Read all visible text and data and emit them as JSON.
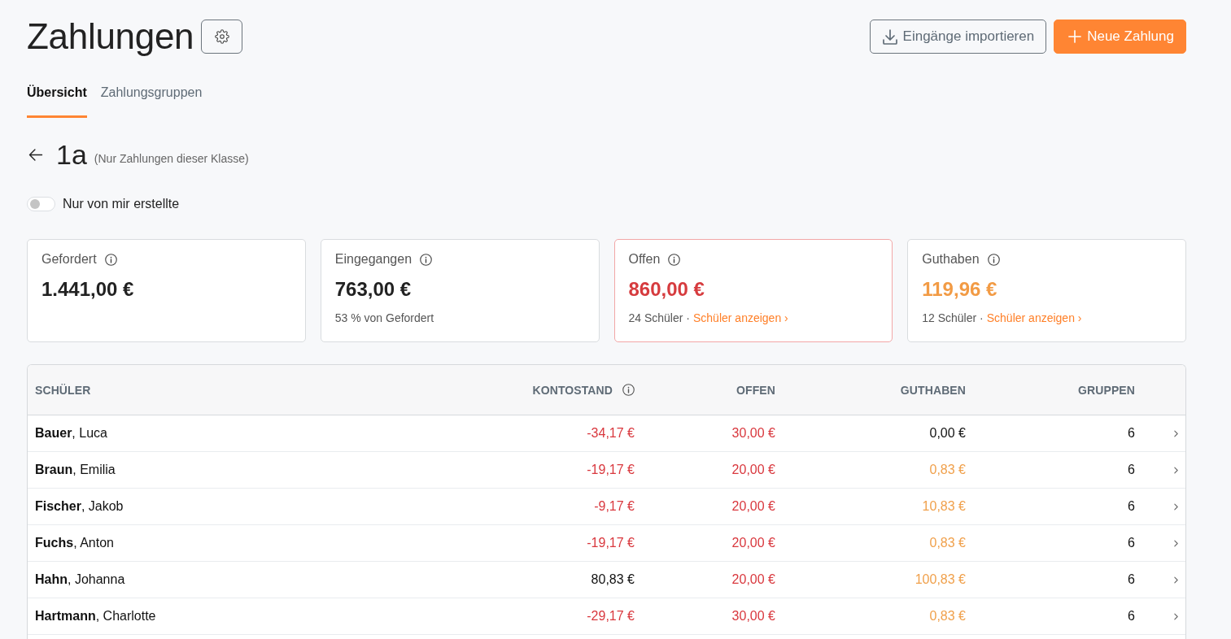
{
  "header": {
    "title": "Zahlungen",
    "actions": [
      {
        "label": "Eingänge importieren",
        "kind": "secondary"
      },
      {
        "label": "Neue Zahlung",
        "kind": "primary"
      }
    ]
  },
  "tabs": [
    {
      "label": "Übersicht",
      "selected": true
    },
    {
      "label": "Zahlungsgruppen",
      "selected": false
    }
  ],
  "class_filter": {
    "title": "1a",
    "subtitle": "(Nur Zahlungen dieser Klasse)"
  },
  "toggle": {
    "label": "Nur von mir erstellte",
    "on": false
  },
  "stats": [
    {
      "label": "Gefordert",
      "value": "1.441,00 €",
      "color": "#222222",
      "alert": false
    },
    {
      "label": "Eingegangen",
      "value": "763,00 €",
      "color": "#222222",
      "note": "53 % von Gefordert",
      "alert": false
    },
    {
      "label": "Offen",
      "value": "860,00 €",
      "color": "#d63b3e",
      "note": "24 Schüler ·",
      "link": "Schüler anzeigen ›",
      "alert": true
    },
    {
      "label": "Guthaben",
      "value": "119,96 €",
      "color": "#f29b45",
      "note": "12 Schüler ·",
      "link": "Schüler anzeigen ›",
      "alert": false
    }
  ],
  "table": {
    "columns": [
      {
        "label": "SCHÜLER",
        "info": false
      },
      {
        "label": "KONTOSTAND",
        "info": true
      },
      {
        "label": "OFFEN",
        "info": false
      },
      {
        "label": "GUTHABEN",
        "info": false
      },
      {
        "label": "GRUPPEN",
        "info": false
      }
    ],
    "rows": [
      {
        "student": "**Bauer**, Luca",
        "balance": {
          "text": "-34,17 €",
          "color": "#d9383e"
        },
        "open": {
          "text": "30,00 €",
          "color": "#d9383e"
        },
        "credit": {
          "text": "0,00 €",
          "color": "#111111"
        },
        "groups": "6"
      },
      {
        "student": "**Braun**, Emilia",
        "balance": {
          "text": "-19,17 €",
          "color": "#d9383e"
        },
        "open": {
          "text": "20,00 €",
          "color": "#d9383e"
        },
        "credit": {
          "text": "0,83 €",
          "color": "#f0a04b"
        },
        "groups": "6"
      },
      {
        "student": "**Fischer**, Jakob",
        "balance": {
          "text": "-9,17 €",
          "color": "#d9383e"
        },
        "open": {
          "text": "20,00 €",
          "color": "#d9383e"
        },
        "credit": {
          "text": "10,83 €",
          "color": "#f0a04b"
        },
        "groups": "6"
      },
      {
        "student": "**Fuchs**, Anton",
        "balance": {
          "text": "-19,17 €",
          "color": "#d9383e"
        },
        "open": {
          "text": "20,00 €",
          "color": "#d9383e"
        },
        "credit": {
          "text": "0,83 €",
          "color": "#f0a04b"
        },
        "groups": "6"
      },
      {
        "student": "**Hahn**, Johanna",
        "balance": {
          "text": "80,83 €",
          "color": "#111111"
        },
        "open": {
          "text": "20,00 €",
          "color": "#d9383e"
        },
        "credit": {
          "text": "100,83 €",
          "color": "#f0a04b"
        },
        "groups": "6"
      },
      {
        "student": "**Hartmann**, Charlotte",
        "balance": {
          "text": "-29,17 €",
          "color": "#d9383e"
        },
        "open": {
          "text": "30,00 €",
          "color": "#d9383e"
        },
        "credit": {
          "text": "0,83 €",
          "color": "#f0a04b"
        },
        "groups": "6"
      }
    ]
  }
}
